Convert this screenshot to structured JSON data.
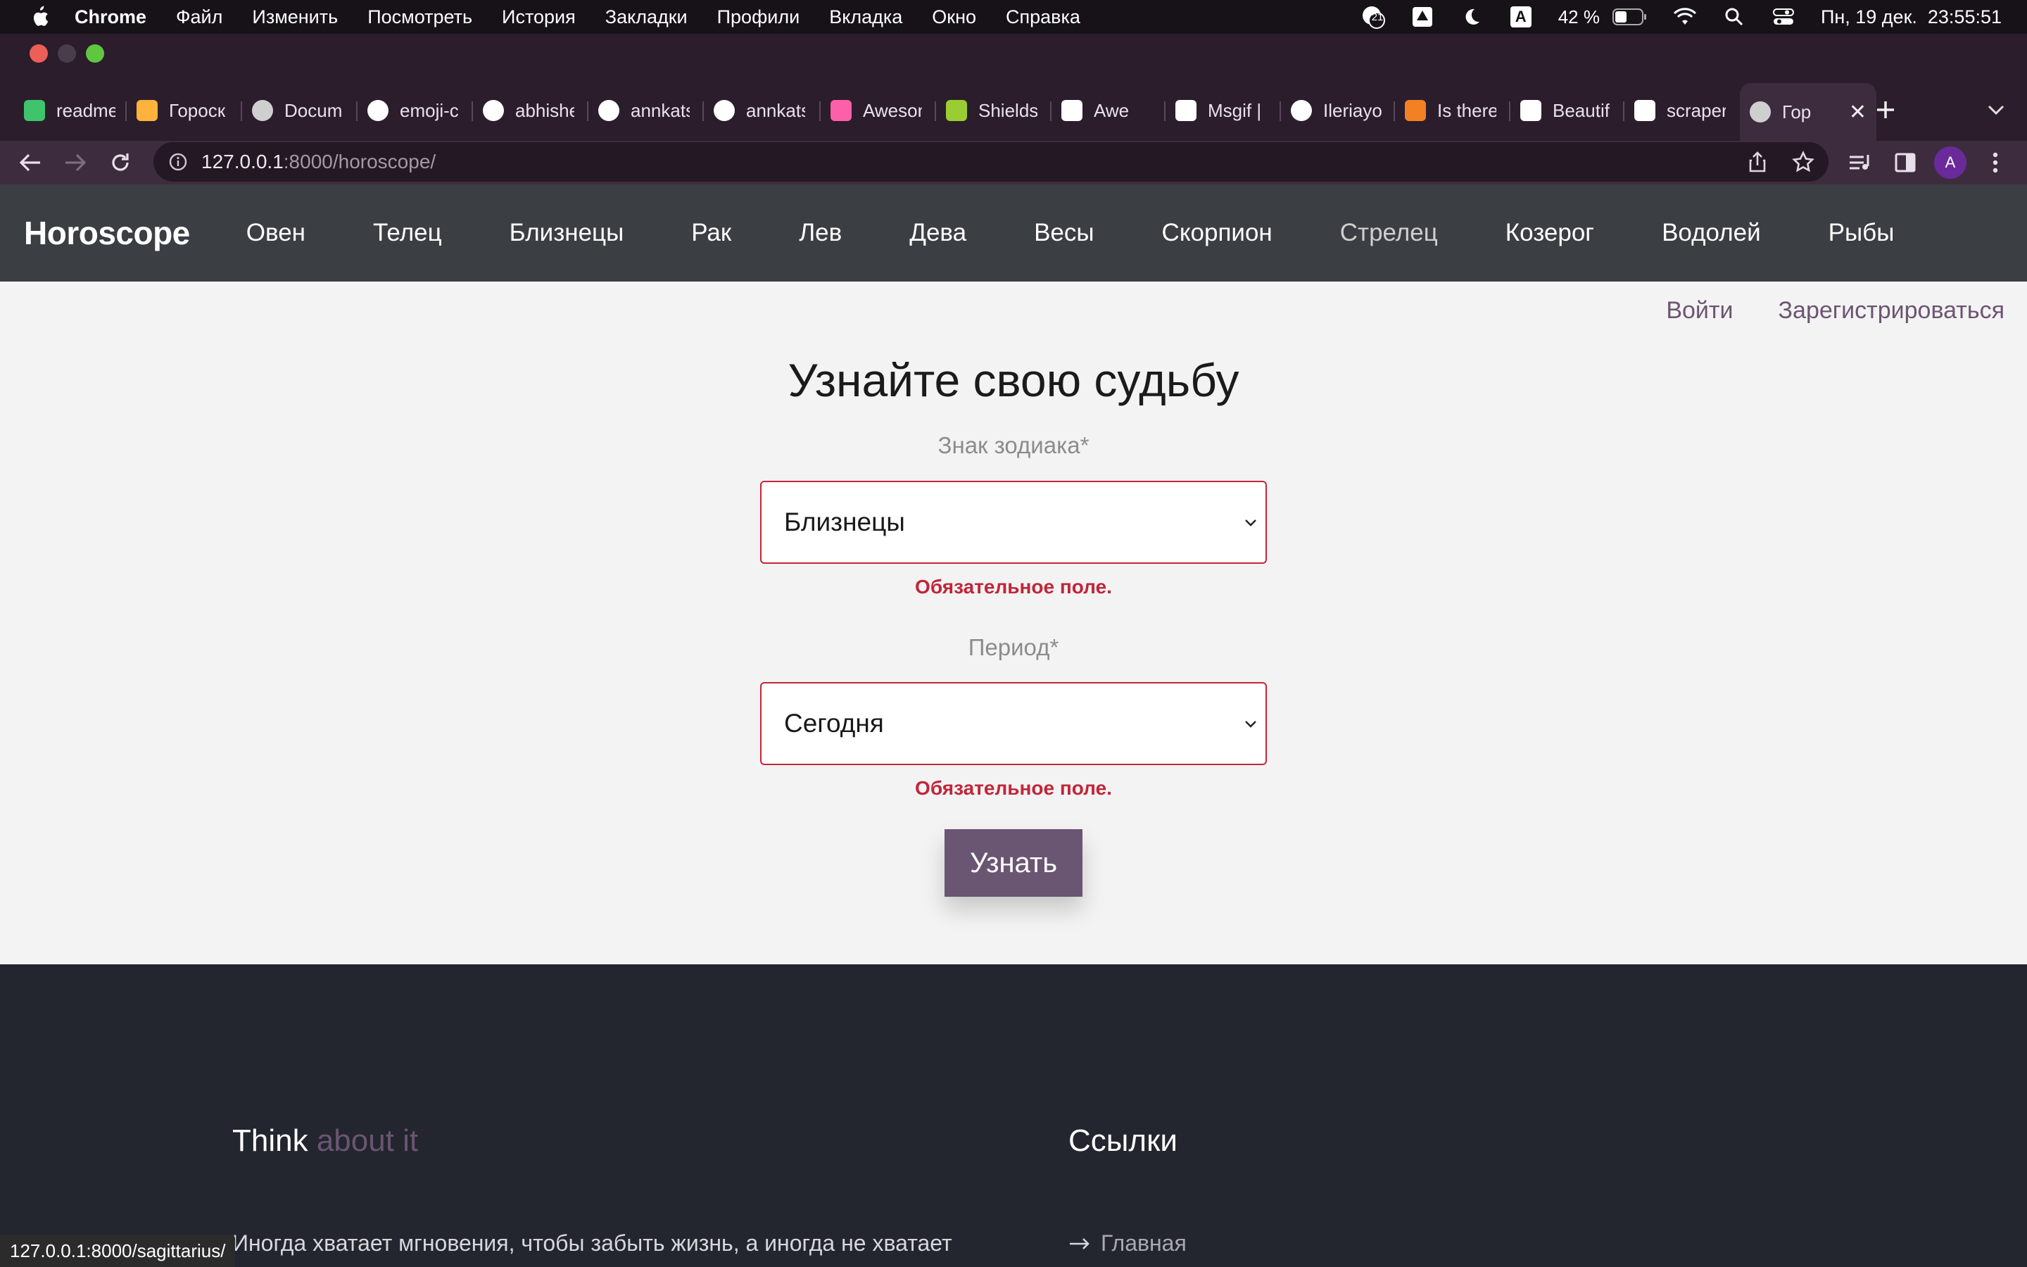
{
  "menubar": {
    "app": "Chrome",
    "items": [
      "Файл",
      "Изменить",
      "Посмотреть",
      "История",
      "Закладки",
      "Профили",
      "Вкладка",
      "Окно",
      "Справка"
    ],
    "notif_count": "21",
    "input_lang": "A",
    "battery": "42 %",
    "datetime": "Пн, 19 дек.  23:55:51"
  },
  "tabs": [
    {
      "title": "readme",
      "icon": "readme-icon",
      "color": "#3ec46d"
    },
    {
      "title": "Гороск",
      "icon": "horoscope-site-icon",
      "color": "#ffb23c"
    },
    {
      "title": "Docum",
      "icon": "globe-icon",
      "color": "#cfcfcf"
    },
    {
      "title": "emoji-c",
      "icon": "github-icon",
      "color": "#ffffff"
    },
    {
      "title": "abhishe",
      "icon": "github-icon",
      "color": "#ffffff"
    },
    {
      "title": "annkats",
      "icon": "github-icon",
      "color": "#ffffff"
    },
    {
      "title": "annkats",
      "icon": "github-icon",
      "color": "#ffffff"
    },
    {
      "title": "Aweson",
      "icon": "awesome-icon",
      "color": "#fc60a8"
    },
    {
      "title": "Shields",
      "icon": "shields-icon",
      "color": "#9acd32"
    },
    {
      "title": "Awe",
      "icon": "dev-icon",
      "color": "#ffffff"
    },
    {
      "title": "Msgif |",
      "icon": "msgif-icon",
      "color": "#ffffff"
    },
    {
      "title": "Ileriayo",
      "icon": "github-icon",
      "color": "#ffffff"
    },
    {
      "title": "Is there",
      "icon": "stackoverflow-icon",
      "color": "#f48024"
    },
    {
      "title": "Beautif",
      "icon": "c-icon",
      "color": "#ffffff"
    },
    {
      "title": "scraper",
      "icon": "google-icon",
      "color": "#ffffff"
    },
    {
      "title": "Гор",
      "icon": "globe-icon",
      "color": "#cfcfcf"
    }
  ],
  "omnibox": {
    "host": "127.0.0.1",
    "path": ":8000/horoscope/"
  },
  "profile_initial": "A",
  "site": {
    "brand": "Horoscope",
    "nav": [
      "Овен",
      "Телец",
      "Близнецы",
      "Рак",
      "Лев",
      "Дева",
      "Весы",
      "Скорпион",
      "Стрелец",
      "Козерог",
      "Водолей",
      "Рыбы"
    ],
    "login": "Войти",
    "register": "Зарегистрироваться"
  },
  "form": {
    "title": "Узнайте свою судьбу",
    "sign_label": "Знак зодиака*",
    "sign_value": "Близнецы",
    "period_label": "Период*",
    "period_value": "Сегодня",
    "error": "Обязательное поле.",
    "submit": "Узнать"
  },
  "footer": {
    "heading_main": "Think",
    "heading_accent": "about it",
    "quote": "Иногда хватает мгновения, чтобы забыть жизнь, а иногда не хватает",
    "links_heading": "Ссылки",
    "link_home": "Главная"
  },
  "statusbar": "127.0.0.1:8000/sagittarius/",
  "colors": {
    "accent": "#6b5572",
    "error": "#c0263a",
    "nav_bg": "#3b3e42",
    "footer_bg": "#23252f"
  }
}
